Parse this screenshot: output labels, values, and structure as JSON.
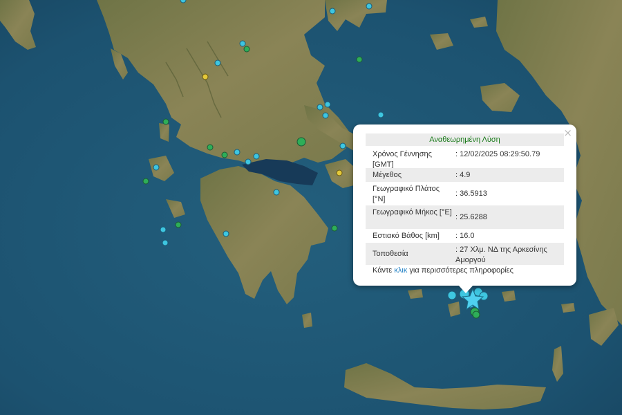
{
  "popup": {
    "title": "Αναθεωρημένη Λύση",
    "close": "×",
    "rows": [
      {
        "label": "Χρόνος Γέννησης [GMT]",
        "value": ": 12/02/2025 08:29:50.79"
      },
      {
        "label": "Μέγεθος",
        "value": ": 4.9"
      },
      {
        "label": "Γεωγραφικό Πλάτος [°N]",
        "value": ": 36.5913"
      },
      {
        "label": "Γεωγραφικό Μήκος [°E]",
        "value": ": 25.6288"
      },
      {
        "label": "Εστιακό Βάθος [km]",
        "value": ": 16.0"
      },
      {
        "label": "Τοποθεσία",
        "value": ": 27 Χλμ. ΝΔ της Αρκεσίνης Αμοργού"
      }
    ],
    "footer_before": "Κάντε ",
    "footer_link": "κλικ",
    "footer_after": " για περισσότερες πληροφορίες"
  },
  "colors": {
    "sea": "#1f5a78",
    "land": "#7c7a4e",
    "marker_cyan": "#3ec6e0",
    "marker_green": "#2eae58",
    "marker_yellow": "#e4c93a",
    "star": "#4fd0ef"
  },
  "icons": {
    "event_marker": "circle",
    "selected_event": "star-icon"
  }
}
